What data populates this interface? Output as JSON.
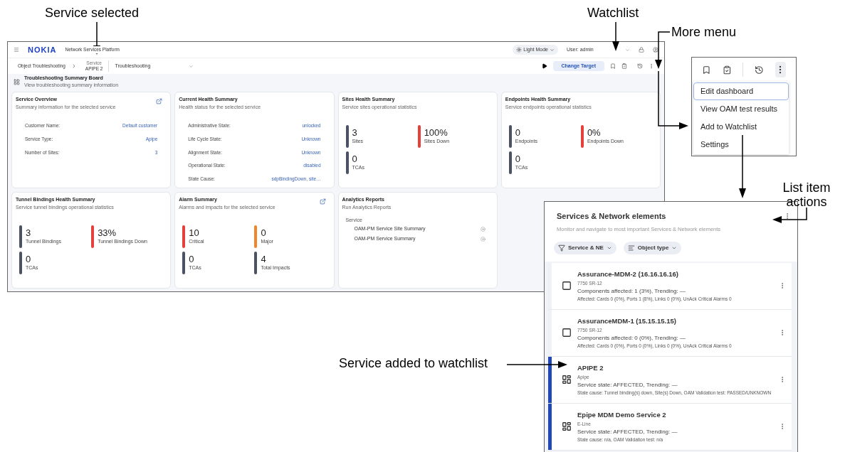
{
  "callouts": {
    "service_selected": "Service selected",
    "watchlist": "Watchlist",
    "more_menu": "More menu",
    "list_item_actions": "List item actions",
    "service_added": "Service added to watchlist"
  },
  "app": {
    "logo": "NOKIA",
    "product": "Network Services Platform",
    "theme": "Light Mode",
    "user": "User: admin",
    "breadcrumb": {
      "root": "Object Troubleshooting",
      "object_type": "Service",
      "object_name": "APIPE 2",
      "view": "Troubleshooting"
    },
    "change_target": "Change Target",
    "board": {
      "title": "Troubleshooting Summary Board",
      "subtitle": "View troubleshooting summary information"
    },
    "cards": [
      {
        "kind": "fields",
        "title": "Service Overview",
        "subtitle": "Summary information for the selected service",
        "link": true,
        "fields": [
          {
            "label": "Customer Name:",
            "value": "Default customer"
          },
          {
            "label": "Service Type:",
            "value": "Apipe"
          },
          {
            "label": "Number of Sites:",
            "value": "3"
          }
        ]
      },
      {
        "kind": "fields",
        "title": "Current Health Summary",
        "subtitle": "Health status for the selected service",
        "link": false,
        "fields": [
          {
            "label": "Administrative State:",
            "value": "unlocked"
          },
          {
            "label": "Life Cycle State:",
            "value": "Unknown"
          },
          {
            "label": "Alignment State:",
            "value": "Unknown"
          },
          {
            "label": "Operational State:",
            "value": "disabled"
          },
          {
            "label": "State Cause:",
            "value": "sdpBindingDown, site…"
          }
        ]
      },
      {
        "kind": "stats",
        "title": "Sites Health Summary",
        "subtitle": "Service sites operational statistics",
        "link": false,
        "stats": [
          {
            "value": "3",
            "label": "Sites",
            "color": "#4a5263"
          },
          {
            "value": "100%",
            "label": "Sites Down",
            "color": "#e5403a"
          },
          {
            "value": "0",
            "label": "TCAs",
            "color": "#4a5263"
          }
        ]
      },
      {
        "kind": "stats",
        "title": "Endpoints Health Summary",
        "subtitle": "Service endpoints operational statistics",
        "link": false,
        "stats": [
          {
            "value": "0",
            "label": "Endpoints",
            "color": "#4a5263"
          },
          {
            "value": "0%",
            "label": "Endpoints Down",
            "color": "#e5403a"
          },
          {
            "value": "0",
            "label": "TCAs",
            "color": "#4a5263"
          }
        ]
      },
      {
        "kind": "stats",
        "title": "Tunnel Bindings Health Summary",
        "subtitle": "Service tunnel bindings operational statistics",
        "link": false,
        "stats": [
          {
            "value": "3",
            "label": "Tunnel Bindings",
            "color": "#4a5263"
          },
          {
            "value": "33%",
            "label": "Tunnel Bindings Down",
            "color": "#e5403a"
          },
          {
            "value": "0",
            "label": "TCAs",
            "color": "#4a5263"
          }
        ]
      },
      {
        "kind": "stats",
        "title": "Alarm Summary",
        "subtitle": "Alarms and impacts for the selected service",
        "link": true,
        "stats": [
          {
            "value": "10",
            "label": "Critical",
            "color": "#e5403a"
          },
          {
            "value": "0",
            "label": "Major",
            "color": "#f0862a"
          },
          {
            "value": "0",
            "label": "TCAs",
            "color": "#4a5263"
          },
          {
            "value": "4",
            "label": "Total Impacts",
            "color": "#4a5263"
          }
        ]
      },
      {
        "kind": "reports",
        "title": "Analytics Reports",
        "subtitle": "Run Analytics Reports",
        "link": false,
        "section": "Service",
        "reports": [
          "OAM-PM Service Site Summary",
          "OAM-PM Service Summary"
        ]
      }
    ]
  },
  "more_menu": {
    "items": [
      {
        "label": "Edit dashboard",
        "selected": true
      },
      {
        "label": "View OAM test results",
        "selected": false
      },
      {
        "label": "Add to Watchlist",
        "selected": false
      },
      {
        "label": "Settings",
        "selected": false
      }
    ]
  },
  "watchlist_panel": {
    "title": "Services & Network elements",
    "subtitle": "Monitor and navigate to most important Services & Network elements",
    "filters": [
      {
        "kind": "filter",
        "label": "Service & NE"
      },
      {
        "kind": "sort",
        "label": "Object type"
      }
    ],
    "items": [
      {
        "kind": "ne",
        "watched": false,
        "title": "Assurance-MDM-2 (16.16.16.16)",
        "type": "7750 SR-12",
        "status": "Components affected: 1 (3%), Trending:  —",
        "detail": "Affected: Cards 0 (0%), Ports 1 (8%), Links 0 (0%), UnAck Critical Alarms 0"
      },
      {
        "kind": "ne",
        "watched": false,
        "title": "AssuranceMDM-1 (15.15.15.15)",
        "type": "7750 SR-12",
        "status": "Components affected: 0 (0%), Trending:  —",
        "detail": "Affected: Cards 0 (0%), Ports 0 (0%), Links 0 (0%), UnAck Critical Alarms 0"
      },
      {
        "kind": "service",
        "watched": true,
        "title": "APIPE 2",
        "type": "Apipe",
        "status": "Service state: AFFECTED, Trending:  —",
        "detail": "State cause: Tunnel binding(s) down, Site(s) Down, OAM Validation test: PASSED/UNKNOWN"
      },
      {
        "kind": "service",
        "watched": true,
        "title": "Epipe MDM Demo Service 2",
        "type": "E-Line",
        "status": "Service state: AFFECTED, Trending:  —",
        "detail": "State cause: n/a, OAM Validation test: n/a"
      }
    ]
  }
}
